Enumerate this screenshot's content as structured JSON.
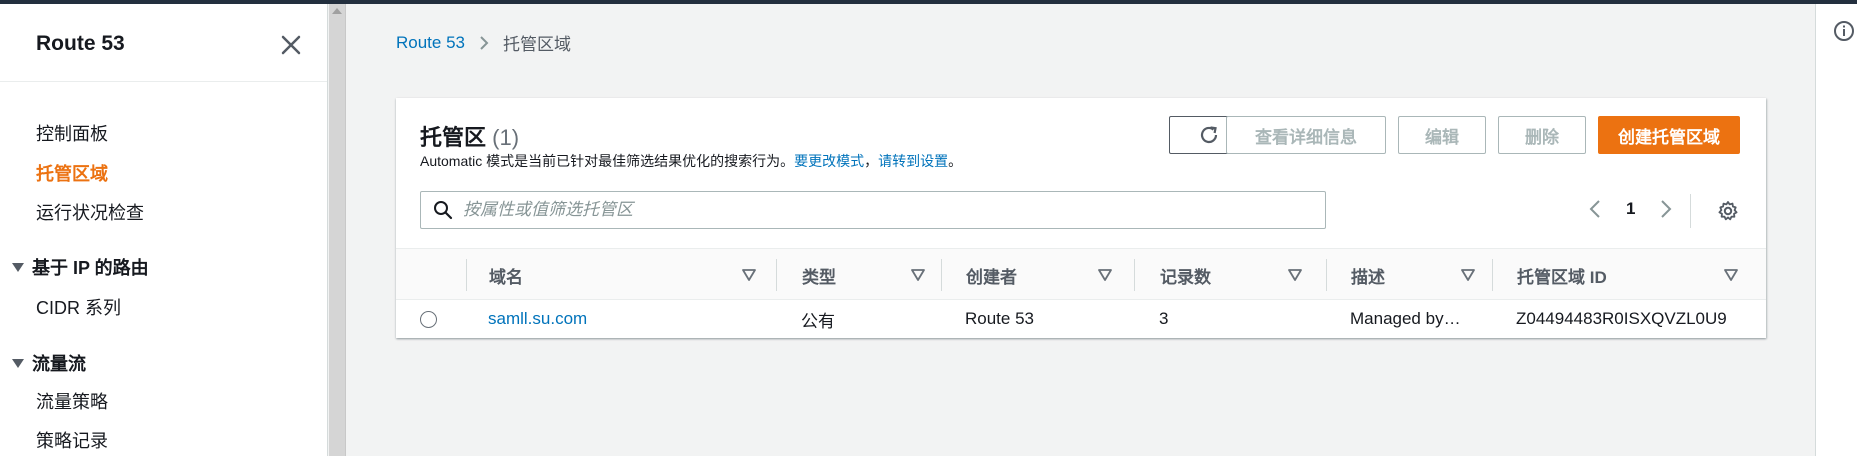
{
  "sidebar": {
    "title": "Route 53",
    "items": [
      {
        "label": "控制面板"
      },
      {
        "label": "托管区域"
      },
      {
        "label": "运行状况检查"
      }
    ],
    "section_ip": {
      "title": "基于 IP 的路由",
      "items": [
        {
          "label": "CIDR 系列"
        }
      ]
    },
    "section_traffic": {
      "title": "流量流",
      "items": [
        {
          "label": "流量策略"
        },
        {
          "label": "策略记录"
        }
      ]
    }
  },
  "breadcrumb": {
    "root": "Route 53",
    "current": "托管区域"
  },
  "panel": {
    "title": "托管区",
    "count": "(1)",
    "description": "Automatic 模式是当前已针对最佳筛选结果优化的搜索行为。",
    "description_link1": "要更改模式",
    "description_mid": "，",
    "description_link2": "请转到设置",
    "description_end": "。",
    "buttons": {
      "view_details": "查看详细信息",
      "edit": "编辑",
      "delete": "删除",
      "create": "创建托管区域"
    },
    "search_placeholder": "按属性或值筛选托管区",
    "page": "1"
  },
  "table": {
    "columns": [
      "域名",
      "类型",
      "创建者",
      "记录数",
      "描述",
      "托管区域 ID"
    ],
    "rows": [
      {
        "domain": "samll.su.com",
        "type": "公有",
        "created_by": "Route 53",
        "record_count": "3",
        "description": "Managed by…",
        "zone_id": "Z04494483R0ISXQVZL0U9"
      }
    ]
  },
  "colors": {
    "accent": "#ec7211",
    "link": "#0073bb",
    "nav_bg": "#232f3e"
  }
}
